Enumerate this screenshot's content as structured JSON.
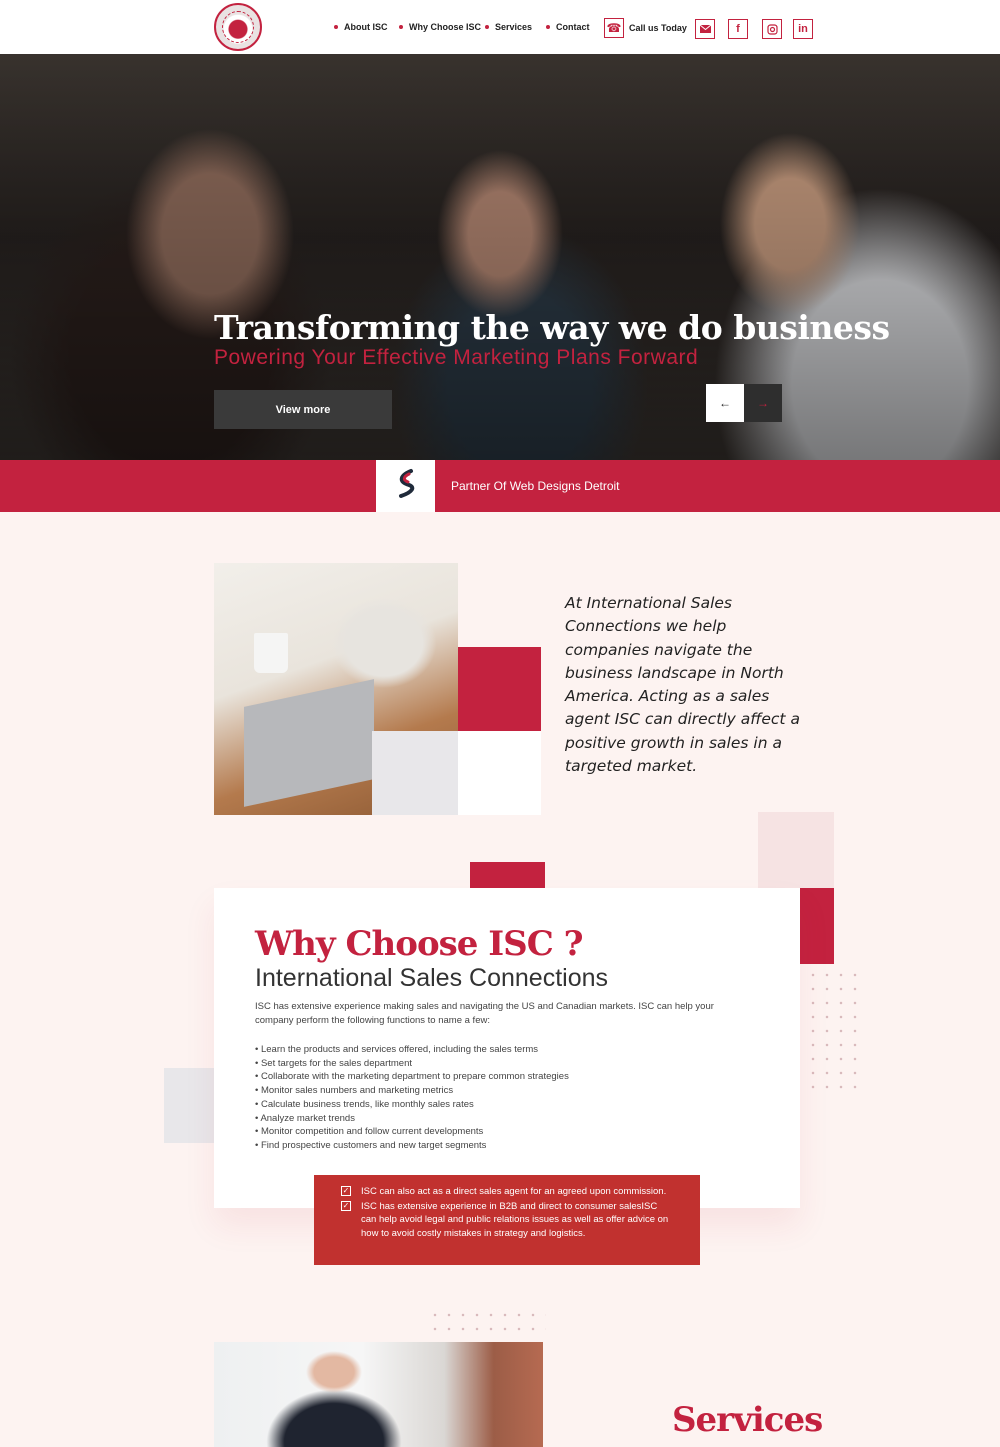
{
  "nav": {
    "items": [
      {
        "label": "About ISC"
      },
      {
        "label": "Why Choose ISC"
      },
      {
        "label": "Services"
      },
      {
        "label": "Contact"
      }
    ],
    "call_label": "Call us Today",
    "icons": [
      "phone-icon",
      "mail-icon",
      "facebook-icon",
      "instagram-icon",
      "linkedin-icon"
    ]
  },
  "hero": {
    "title": "Transforming the way we do business",
    "subtitle": "Powering Your Effective Marketing Plans Forward",
    "button_label": "View more",
    "prev_arrow": "←",
    "next_arrow": "→"
  },
  "partner": {
    "text": "Partner Of Web Designs Detroit"
  },
  "intro": {
    "text": "At International Sales Connections we help companies navigate the business landscape in North America. Acting as a sales agent ISC can directly affect a positive growth in sales in a targeted market."
  },
  "why": {
    "title": "Why Choose ISC ?",
    "subtitle": "International Sales Connections",
    "description": "ISC has extensive experience making sales and navigating the US and Canadian markets.  ISC can help your company perform the following functions to name a few:",
    "functions": [
      "• Learn the products and services offered, including the sales terms",
      "• Set targets for the sales department",
      "• Collaborate with the marketing department to prepare common strategies",
      "• Monitor sales numbers and marketing metrics",
      "• Calculate business trends, like monthly sales rates",
      "• Analyze market trends",
      "• Monitor competition and follow current developments",
      "• Find prospective customers and new target segments"
    ],
    "highlights": [
      "ISC can also act as a direct sales agent for an agreed upon commission.",
      "ISC has extensive experience in  B2B and direct to consumer salesISC can help avoid legal and public relations issues as well as offer advice on how  to avoid costly mistakes in strategy and logistics."
    ]
  },
  "services": {
    "title": "Services"
  },
  "colors": {
    "accent": "#c3223f",
    "highlight_bg": "#c1312f",
    "page_bg": "#fdf3f1"
  }
}
